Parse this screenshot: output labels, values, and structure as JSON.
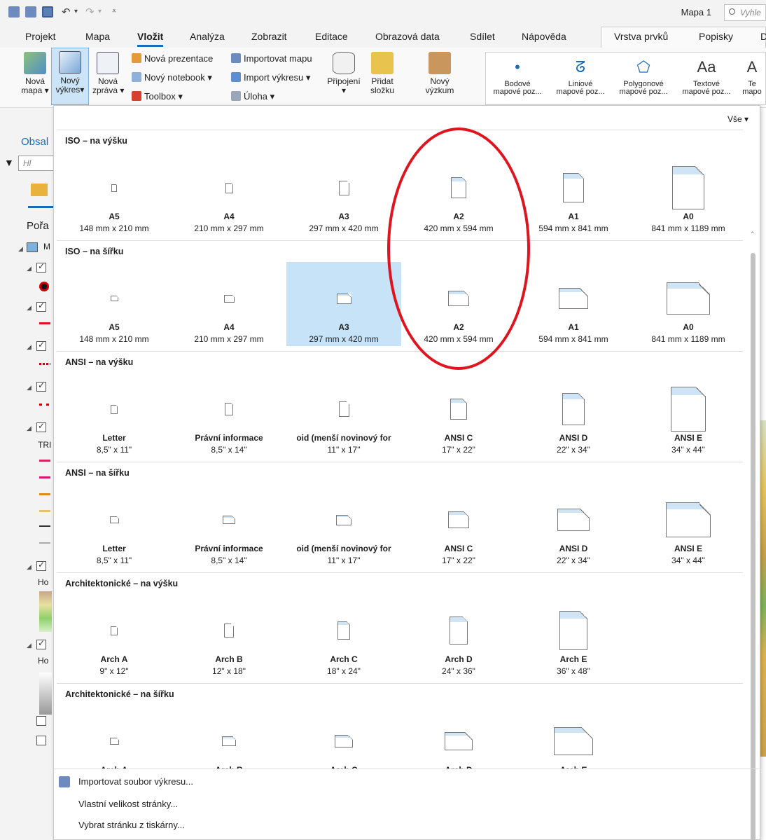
{
  "quick_access": {
    "title": "Mapa 1",
    "search_placeholder": "Vyhle"
  },
  "tabs": [
    "Projekt",
    "Mapa",
    "Vložit",
    "Analýza",
    "Zobrazit",
    "Editace",
    "Obrazová data",
    "Sdílet",
    "Nápověda",
    "Vrstva prvků",
    "Popisky",
    "D"
  ],
  "active_tab": "Vložit",
  "ribbon": {
    "new_map": "Nová\nmapa ▾",
    "new_layout": "Nový\nvýkres▾",
    "new_report": "Nová\nzpráva ▾",
    "new_presentation": "Nová prezentace",
    "new_notebook": "Nový notebook ▾",
    "toolbox": "Toolbox ▾",
    "import_map": "Importovat mapu",
    "import_layout": "Import výkresu ▾",
    "task": "Úloha ▾",
    "connect": "Připojení",
    "connect_arrow": "▾",
    "add_folder": "Přidat\nsložku",
    "new_research": "Nový\nvýzkum",
    "gallery": [
      {
        "icon": "•",
        "label": "Bodové\nmapové poz..."
      },
      {
        "icon": "ᘔ",
        "label": "Liniové\nmapové poz..."
      },
      {
        "icon": "⬠",
        "label": "Polygonové\nmapové poz..."
      },
      {
        "icon": "Aa",
        "label": "Textové\nmapové poz..."
      },
      {
        "icon": "A",
        "label": "Te\nmapo"
      }
    ]
  },
  "left_pane": {
    "title": "Obsal",
    "filter_placeholder": "Hl",
    "order_label": "Pořa",
    "layer_m": "M",
    "tr_label": "TRI",
    "ho1": "Ho",
    "ho2": "Ho"
  },
  "dropdown": {
    "filter_label": "Vše ▾",
    "sections": [
      {
        "title": "ISO – na výšku",
        "items": [
          {
            "name": "A5",
            "size": "148 mm x 210 mm"
          },
          {
            "name": "A4",
            "size": "210 mm x 297 mm"
          },
          {
            "name": "A3",
            "size": "297 mm x 420 mm"
          },
          {
            "name": "A2",
            "size": "420 mm x 594 mm"
          },
          {
            "name": "A1",
            "size": "594 mm x 841 mm"
          },
          {
            "name": "A0",
            "size": "841 mm x 1189 mm"
          }
        ]
      },
      {
        "title": "ISO – na šířku",
        "items": [
          {
            "name": "A5",
            "size": "148 mm x 210 mm"
          },
          {
            "name": "A4",
            "size": "210 mm x 297 mm"
          },
          {
            "name": "A3",
            "size": "297 mm x 420 mm"
          },
          {
            "name": "A2",
            "size": "420 mm x 594 mm"
          },
          {
            "name": "A1",
            "size": "594 mm x 841 mm"
          },
          {
            "name": "A0",
            "size": "841 mm x 1189 mm"
          }
        ]
      },
      {
        "title": "ANSI – na výšku",
        "items": [
          {
            "name": "Letter",
            "size": "8,5\" x 11\""
          },
          {
            "name": "Právní informace",
            "size": "8,5\" x 14\""
          },
          {
            "name": "oid (menší novinový for",
            "size": "11\" x 17\""
          },
          {
            "name": "ANSI C",
            "size": "17\" x 22\""
          },
          {
            "name": "ANSI D",
            "size": "22\" x 34\""
          },
          {
            "name": "ANSI E",
            "size": "34\" x 44\""
          }
        ]
      },
      {
        "title": "ANSI – na šířku",
        "items": [
          {
            "name": "Letter",
            "size": "8,5\" x 11\""
          },
          {
            "name": "Právní informace",
            "size": "8,5\" x 14\""
          },
          {
            "name": "oid (menší novinový for",
            "size": "11\" x 17\""
          },
          {
            "name": "ANSI C",
            "size": "17\" x 22\""
          },
          {
            "name": "ANSI D",
            "size": "22\" x 34\""
          },
          {
            "name": "ANSI E",
            "size": "34\" x 44\""
          }
        ]
      },
      {
        "title": "Architektonické – na výšku",
        "items": [
          {
            "name": "Arch A",
            "size": "9\" x 12\""
          },
          {
            "name": "Arch B",
            "size": "12\" x 18\""
          },
          {
            "name": "Arch C",
            "size": "18\" x 24\""
          },
          {
            "name": "Arch D",
            "size": "24\" x 36\""
          },
          {
            "name": "Arch E",
            "size": "36\" x 48\""
          }
        ]
      },
      {
        "title": "Architektonické – na šířku",
        "items": [
          {
            "name": "Arch A",
            "size": ""
          },
          {
            "name": "Arch B",
            "size": ""
          },
          {
            "name": "Arch C",
            "size": ""
          },
          {
            "name": "Arch D",
            "size": ""
          },
          {
            "name": "Arch E",
            "size": ""
          }
        ]
      }
    ],
    "selected": {
      "section": 1,
      "item": 2
    },
    "menu": [
      "Importovat soubor výkresu...",
      "Vlastní velikost stránky...",
      "Vybrat stránku z tiskárny..."
    ]
  },
  "highlight_color": "#e0141e",
  "accent_color": "#1a6bb5"
}
